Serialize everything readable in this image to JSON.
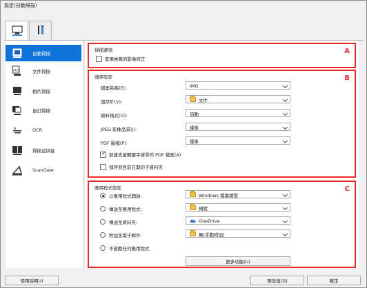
{
  "window": {
    "title": "設定(自動掃描)"
  },
  "tabs": [
    {
      "icon": "scanner-computer-icon",
      "selected": true
    },
    {
      "icon": "tools-settings-icon",
      "selected": false
    }
  ],
  "sidebar": {
    "items": [
      {
        "label": "自動掃描",
        "selected": true,
        "icon": "auto-scan-icon"
      },
      {
        "label": "文件掃描",
        "selected": false,
        "icon": "document-scan-icon"
      },
      {
        "label": "相片掃描",
        "selected": false,
        "icon": "photo-scan-icon"
      },
      {
        "label": "自訂掃描",
        "selected": false,
        "icon": "custom-scan-icon"
      },
      {
        "label": "OCR",
        "selected": false,
        "icon": "ocr-icon"
      },
      {
        "label": "掃描並拼接",
        "selected": false,
        "icon": "scan-stitch-icon"
      },
      {
        "label": "ScanGear",
        "selected": false,
        "icon": "scangear-icon"
      }
    ]
  },
  "sections": {
    "a": {
      "title": "掃描選項",
      "badge": "A",
      "checkbox_label": "套用推薦的影像校正",
      "checkbox_checked": false
    },
    "b": {
      "title": "儲存設定",
      "badge": "B",
      "fields": [
        {
          "label": "檔案名稱(E):",
          "value": "IMG"
        },
        {
          "label": "儲存於(V):",
          "value": "文件"
        },
        {
          "label": "資料格式(O):",
          "value": "自動"
        },
        {
          "label": "JPEG 影像品質(J):",
          "value": "標準"
        },
        {
          "label": "PDF 壓縮(P):",
          "value": "標準"
        }
      ],
      "checkbox_1_label": "創建支援關鍵字搜尋的 PDF 檔案(A)",
      "checkbox_1_checked": true,
      "checkbox_2_label": "儲存到目前日期的子資料夾",
      "checkbox_2_checked": false
    },
    "c": {
      "title": "應用程式設定",
      "badge": "C",
      "options": [
        {
          "label": "以應用程式開啟:",
          "value": "Windows 檔案總管",
          "selected": true,
          "icon": "explorer-icon"
        },
        {
          "label": "傳送至應用程式:",
          "value": "預覽",
          "selected": false,
          "icon": "folder-icon"
        },
        {
          "label": "傳送至資料夾:",
          "value": "OneDrive",
          "selected": false,
          "icon": "cloud-icon"
        },
        {
          "label": "附加至電子郵件:",
          "value": "無(手動附加)",
          "selected": false,
          "icon": "folder-icon"
        },
        {
          "label": "不啟動任何應用程式",
          "selected": false
        }
      ],
      "more_button": "更多功能(U)"
    }
  },
  "footer": {
    "help_button": "使用說明(I)",
    "defaults_button": "預設值(D)",
    "ok_button": "確定"
  },
  "colors": {
    "selection_blue": "#0f73d9",
    "highlight_red": "#e52926",
    "panel_gray": "#f0f0f0"
  }
}
